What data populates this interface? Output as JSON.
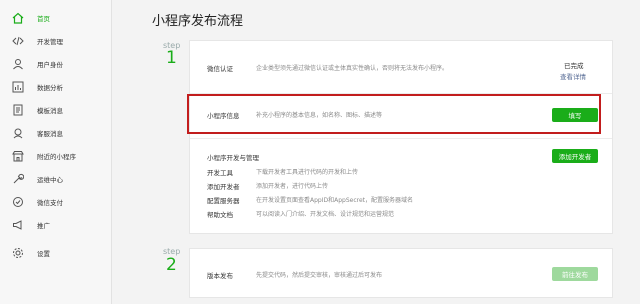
{
  "sidebar": {
    "items": [
      {
        "label": "首页",
        "icon": "home-icon"
      },
      {
        "label": "开发管理",
        "icon": "code-icon"
      },
      {
        "label": "用户身份",
        "icon": "user-icon"
      },
      {
        "label": "数据分析",
        "icon": "chart-icon"
      },
      {
        "label": "模板消息",
        "icon": "document-icon"
      },
      {
        "label": "客服消息",
        "icon": "chat-icon"
      },
      {
        "label": "附近的小程序",
        "icon": "store-icon"
      },
      {
        "label": "运维中心",
        "icon": "wrench-icon"
      },
      {
        "label": "微信支付",
        "icon": "pay-icon"
      },
      {
        "label": "推广",
        "icon": "megaphone-icon"
      },
      {
        "label": "设置",
        "icon": "gear-icon"
      }
    ]
  },
  "main": {
    "title": "小程序发布流程",
    "step1": {
      "label": "step",
      "num": "1"
    },
    "step2": {
      "label": "step",
      "num": "2"
    },
    "row_verify": {
      "title": "微信认证",
      "desc": "企业类型须先通过微信认证或主体真实性确认，否则将无法发布小程序。",
      "status": "已完成",
      "link": "查看详情"
    },
    "row_info": {
      "title": "小程序信息",
      "desc": "补充小程序的基本信息，如名称、图标、描述等",
      "button": "填写"
    },
    "row_dev": {
      "title": "小程序开发与管理",
      "button": "添加开发者",
      "items": [
        {
          "key": "开发工具",
          "val": "下载开发者工具进行代码的开发和上传"
        },
        {
          "key": "添加开发者",
          "val": "添加开发者，进行代码上传"
        },
        {
          "key": "配置服务器",
          "val": "在开发设置页面查看AppID和AppSecret，配置服务器域名"
        },
        {
          "key": "帮助文档",
          "val": "可以阅读入门介绍、开发文档、设计规范和运营规范"
        }
      ]
    },
    "row_release": {
      "title": "版本发布",
      "desc": "先提交代码，然后提交审核，审核通过后可发布",
      "button": "前往发布"
    }
  },
  "colors": {
    "accent": "#1aad19",
    "highlight": "#c21d1d",
    "link": "#576b95"
  }
}
